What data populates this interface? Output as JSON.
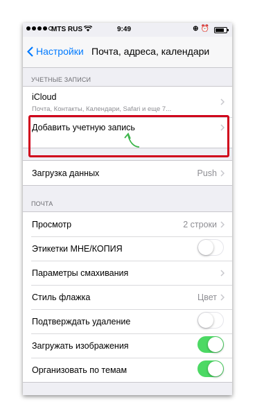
{
  "status_bar": {
    "carrier": "MTS RUS",
    "time": "9:49",
    "signal_dots": [
      true,
      true,
      true,
      true,
      false
    ]
  },
  "navbar": {
    "back_label": "Настройки",
    "title": "Почта, адреса, календари"
  },
  "accounts_section": {
    "header": "УЧЕТНЫЕ ЗАПИСИ",
    "icloud": {
      "label": "iCloud",
      "subtitle": "Почта, Контакты, Календари, Safari и еще 7..."
    },
    "add_account": {
      "label": "Добавить учетную запись"
    }
  },
  "fetch_section": {
    "label": "Загрузка данных",
    "value": "Push"
  },
  "mail_section": {
    "header": "ПОЧТА",
    "preview": {
      "label": "Просмотр",
      "value": "2 строки"
    },
    "to_cc": {
      "label": "Этикетки МНЕ/КОПИЯ",
      "on": false
    },
    "swipe": {
      "label": "Параметры смахивания"
    },
    "flag_style": {
      "label": "Стиль флажка",
      "value": "Цвет"
    },
    "ask_delete": {
      "label": "Подтверждать удаление",
      "on": false
    },
    "load_images": {
      "label": "Загружать изображения",
      "on": true
    },
    "organize_thread": {
      "label": "Организовать по темам",
      "on": true
    }
  },
  "colors": {
    "accent": "#007aff",
    "toggle_on": "#4cd964",
    "highlight": "#d0021b",
    "arrow": "#3cb54a"
  }
}
